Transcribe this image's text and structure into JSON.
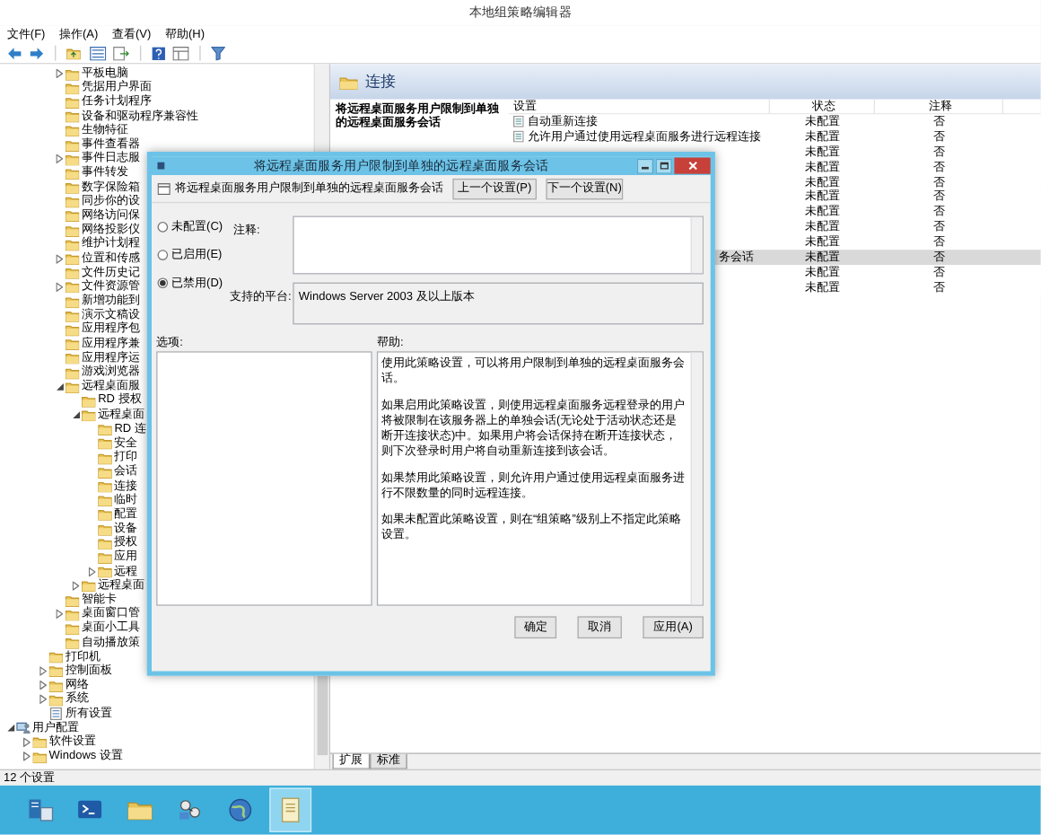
{
  "window": {
    "title": "本地组策略编辑器"
  },
  "menu": [
    "文件(F)",
    "操作(A)",
    "查看(V)",
    "帮助(H)"
  ],
  "tree": [
    {
      "children": [
        {
          "children": [
            {
              "children": [
                {
                  "label": "平板电脑",
                  "kind": "folder",
                  "expanded": false
                },
                {
                  "label": "凭据用户界面",
                  "kind": "folder"
                },
                {
                  "label": "任务计划程序",
                  "kind": "folder"
                },
                {
                  "label": "设备和驱动程序兼容性",
                  "kind": "folder"
                },
                {
                  "label": "生物特征",
                  "kind": "folder"
                },
                {
                  "label": "事件查看器",
                  "kind": "folder"
                },
                {
                  "label": "事件日志服",
                  "kind": "folder",
                  "expanded": false
                },
                {
                  "label": "事件转发",
                  "kind": "folder"
                },
                {
                  "label": "数字保险箱",
                  "kind": "folder"
                },
                {
                  "label": "同步你的设",
                  "kind": "folder"
                },
                {
                  "label": "网络访问保",
                  "kind": "folder"
                },
                {
                  "label": "网络投影仪",
                  "kind": "folder"
                },
                {
                  "label": "维护计划程",
                  "kind": "folder"
                },
                {
                  "label": "位置和传感",
                  "kind": "folder",
                  "expanded": false
                },
                {
                  "label": "文件历史记",
                  "kind": "folder"
                },
                {
                  "label": "文件资源管",
                  "kind": "folder",
                  "expanded": false
                },
                {
                  "label": "新增功能到",
                  "kind": "folder"
                },
                {
                  "label": "演示文稿设",
                  "kind": "folder"
                },
                {
                  "label": "应用程序包",
                  "kind": "folder"
                },
                {
                  "label": "应用程序兼",
                  "kind": "folder"
                },
                {
                  "label": "应用程序运",
                  "kind": "folder"
                },
                {
                  "label": "游戏浏览器",
                  "kind": "folder"
                },
                {
                  "label": "远程桌面服",
                  "kind": "folder",
                  "expanded": true,
                  "children": [
                    {
                      "label": "RD 授权",
                      "kind": "folder"
                    },
                    {
                      "label": "远程桌面",
                      "kind": "folder",
                      "expanded": true,
                      "children": [
                        {
                          "label": "RD 连",
                          "kind": "folder"
                        },
                        {
                          "label": "安全",
                          "kind": "folder"
                        },
                        {
                          "label": "打印",
                          "kind": "folder"
                        },
                        {
                          "label": "会话",
                          "kind": "folder"
                        },
                        {
                          "label": "连接",
                          "kind": "folder"
                        },
                        {
                          "label": "临时",
                          "kind": "folder"
                        },
                        {
                          "label": "配置",
                          "kind": "folder"
                        },
                        {
                          "label": "设备",
                          "kind": "folder"
                        },
                        {
                          "label": "授权",
                          "kind": "folder"
                        },
                        {
                          "label": "应用",
                          "kind": "folder"
                        },
                        {
                          "label": "远程",
                          "kind": "folder",
                          "expanded": false
                        }
                      ]
                    },
                    {
                      "label": "远程桌面",
                      "kind": "folder",
                      "expanded": false
                    }
                  ]
                },
                {
                  "label": "智能卡",
                  "kind": "folder"
                },
                {
                  "label": "桌面窗口管",
                  "kind": "folder",
                  "expanded": false
                },
                {
                  "label": "桌面小工具",
                  "kind": "folder"
                },
                {
                  "label": "自动播放策",
                  "kind": "folder"
                }
              ]
            },
            {
              "label": "打印机",
              "kind": "folder"
            },
            {
              "label": "控制面板",
              "kind": "folder",
              "expanded": false
            },
            {
              "label": "网络",
              "kind": "folder",
              "expanded": false
            },
            {
              "label": "系统",
              "kind": "folder",
              "expanded": false
            },
            {
              "label": "所有设置",
              "kind": "settings"
            }
          ]
        }
      ]
    },
    {
      "label": "用户配置",
      "kind": "user",
      "expanded": true,
      "children": [
        {
          "label": "软件设置",
          "kind": "folder",
          "expanded": false
        },
        {
          "label": "Windows 设置",
          "kind": "folder",
          "expanded": false
        }
      ]
    }
  ],
  "details": {
    "header": "连接",
    "description": "将远程桌面服务用户限制到单独的远程桌面服务会话",
    "columns": [
      "设置",
      "状态",
      "注释"
    ],
    "rows": [
      {
        "kind": "full",
        "setting": "自动重新连接",
        "status": "未配置",
        "comment": "否",
        "selected": false
      },
      {
        "kind": "full",
        "setting": "允许用户通过使用远程桌面服务进行远程连接",
        "status": "未配置",
        "comment": "否",
        "selected": false
      },
      {
        "kind": "hidden",
        "status": "未配置",
        "comment": "否",
        "selected": false
      },
      {
        "kind": "hidden",
        "status": "未配置",
        "comment": "否",
        "selected": false
      },
      {
        "kind": "hidden",
        "status": "未配置",
        "comment": "否",
        "selected": false
      },
      {
        "kind": "hidden",
        "status": "未配置",
        "comment": "否",
        "selected": false
      },
      {
        "kind": "hidden",
        "status": "未配置",
        "comment": "否",
        "selected": false
      },
      {
        "kind": "hidden",
        "status": "未配置",
        "comment": "否",
        "selected": false
      },
      {
        "kind": "hidden",
        "status": "未配置",
        "comment": "否",
        "selected": false
      },
      {
        "kind": "clipped",
        "setting": "务会话",
        "status": "未配置",
        "comment": "否",
        "selected": true
      },
      {
        "kind": "hidden",
        "status": "未配置",
        "comment": "否",
        "selected": false
      },
      {
        "kind": "hidden",
        "status": "未配置",
        "comment": "否",
        "selected": false
      }
    ],
    "tabs": [
      {
        "label": "扩展",
        "selected": true
      },
      {
        "label": "标准",
        "selected": false
      }
    ]
  },
  "status_bar": "12 个设置",
  "taskbar": [
    {
      "selected": false
    },
    {
      "selected": false
    },
    {
      "selected": false
    },
    {
      "selected": false
    },
    {
      "selected": false
    },
    {
      "selected": true
    }
  ],
  "dialog": {
    "title": "将远程桌面服务用户限制到单独的远程桌面服务会话",
    "heading": "将远程桌面服务用户限制到单独的远程桌面服务会话",
    "prev_button": "上一个设置(P)",
    "next_button": "下一个设置(N)",
    "radios": [
      {
        "label": "未配置(C)",
        "selected": false
      },
      {
        "label": "已启用(E)",
        "selected": false
      },
      {
        "label": "已禁用(D)",
        "selected": true
      }
    ],
    "comment_label": "注释:",
    "platform_label": "支持的平台:",
    "platform": "Windows Server 2003 及以上版本",
    "options_label": "选项:",
    "help_label": "帮助:",
    "help": [
      "使用此策略设置，可以将用户限制到单独的远程桌面服务会话。",
      "如果启用此策略设置，则使用远程桌面服务远程登录的用户将被限制在该服务器上的单独会话(无论处于活动状态还是断开连接状态)中。如果用户将会话保持在断开连接状态，则下次登录时用户将自动重新连接到该会话。",
      "如果禁用此策略设置，则允许用户通过使用远程桌面服务进行不限数量的同时远程连接。",
      "如果未配置此策略设置，则在“组策略”级别上不指定此策略设置。"
    ],
    "buttons": [
      "确定",
      "取消",
      "应用(A)"
    ]
  }
}
